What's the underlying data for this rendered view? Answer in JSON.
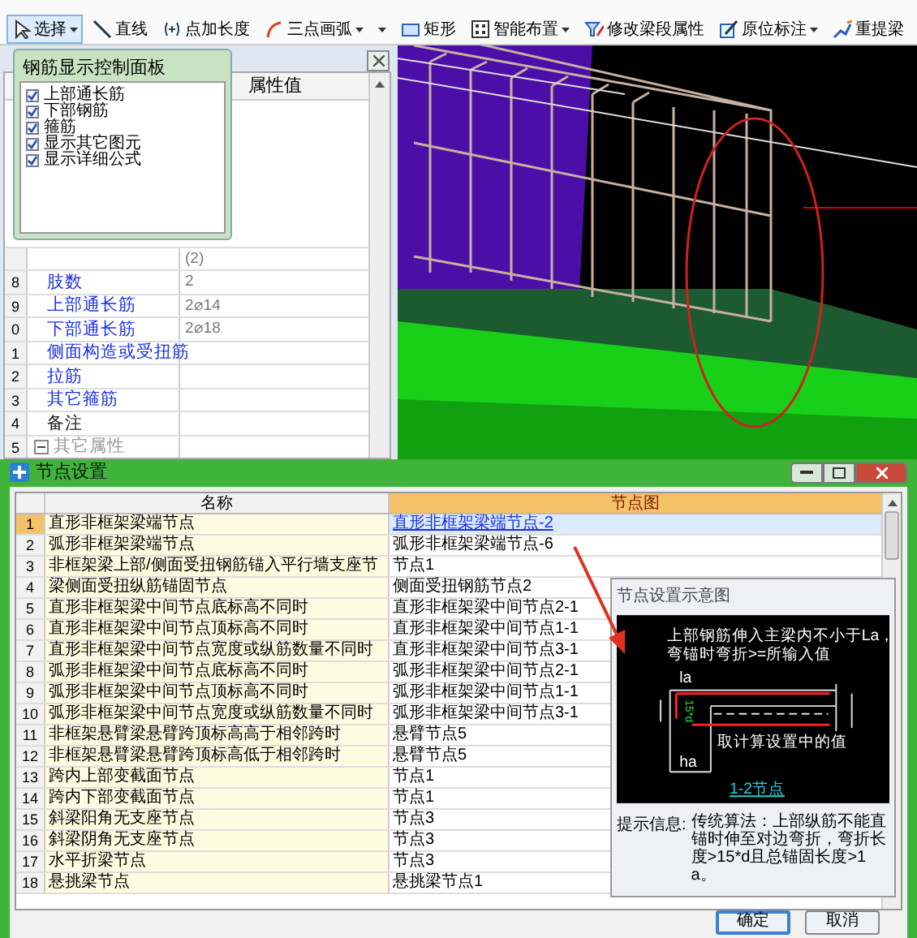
{
  "toolbar": {
    "items": [
      {
        "kind": "select",
        "label": "选择",
        "dropdown": true,
        "selected": true
      },
      {
        "kind": "line",
        "label": "直线",
        "dropdown": false,
        "selected": false
      },
      {
        "kind": "point-length",
        "label": "点加长度",
        "dropdown": false,
        "selected": false
      },
      {
        "kind": "arc",
        "label": "三点画弧",
        "dropdown": true,
        "selected": false
      },
      {
        "kind": "menu",
        "dropdown": true,
        "selected": false
      },
      {
        "kind": "rect",
        "label": "矩形",
        "dropdown": false,
        "selected": false
      },
      {
        "kind": "smart",
        "label": "智能布置",
        "dropdown": true,
        "selected": false
      },
      {
        "kind": "edit",
        "label": "修改梁段属性",
        "dropdown": false,
        "selected": false
      },
      {
        "kind": "annotate",
        "label": "原位标注",
        "dropdown": true,
        "selected": false
      },
      {
        "kind": "extract",
        "label": "重提梁",
        "dropdown": false,
        "selected": false
      }
    ]
  },
  "property_grid": {
    "header": "属性值",
    "rows": [
      {
        "value": "(2)"
      },
      {
        "number": "8",
        "name": "肢数",
        "value": "2",
        "kind": "link"
      },
      {
        "number": "9",
        "name": "上部通长筋",
        "value": "2⌀14",
        "kind": "link"
      },
      {
        "number": "0",
        "name": "下部通长筋",
        "value": "2⌀18",
        "kind": "link"
      },
      {
        "number": "1",
        "name": "侧面构造或受扭筋",
        "kind": "link"
      },
      {
        "number": "2",
        "name": "拉筋",
        "kind": "link"
      },
      {
        "number": "3",
        "name": "其它箍筋",
        "kind": "link"
      },
      {
        "number": "4",
        "name": "备注",
        "kind": "plain"
      },
      {
        "number": "5",
        "name": "其它属性",
        "kind": "group",
        "expanded": true
      }
    ]
  },
  "rebar_panel": {
    "title": "钢筋显示控制面板",
    "items": [
      {
        "label": "上部通长筋",
        "checked": true
      },
      {
        "label": "下部钢筋",
        "checked": true
      },
      {
        "label": "箍筋",
        "checked": true
      },
      {
        "label": "显示其它图元",
        "checked": true
      },
      {
        "label": "显示详细公式",
        "checked": true
      }
    ]
  },
  "node_dialog": {
    "title": "节点设置",
    "columns": [
      "名称",
      "节点图"
    ],
    "rows": [
      {
        "number": "1",
        "name": "直形非框架梁端节点",
        "node": "直形非框架梁端节点-2",
        "selected": true
      },
      {
        "number": "2",
        "name": "弧形非框架梁端节点",
        "node": "弧形非框架梁端节点-6",
        "selected": false
      },
      {
        "number": "3",
        "name": "非框架梁上部/侧面受扭钢筋锚入平行墙支座节",
        "node": "节点1",
        "selected": false
      },
      {
        "number": "4",
        "name": "梁侧面受扭纵筋锚固节点",
        "node": "侧面受扭钢筋节点2",
        "selected": false
      },
      {
        "number": "5",
        "name": "直形非框架梁中间节点底标高不同时",
        "node": "直形非框架梁中间节点2-1",
        "selected": false
      },
      {
        "number": "6",
        "name": "直形非框架梁中间节点顶标高不同时",
        "node": "直形非框架梁中间节点1-1",
        "selected": false
      },
      {
        "number": "7",
        "name": "直形非框架梁中间节点宽度或纵筋数量不同时",
        "node": "直形非框架梁中间节点3-1",
        "selected": false
      },
      {
        "number": "8",
        "name": "弧形非框架梁中间节点底标高不同时",
        "node": "弧形非框架梁中间节点2-1",
        "selected": false
      },
      {
        "number": "9",
        "name": "弧形非框架梁中间节点顶标高不同时",
        "node": "弧形非框架梁中间节点1-1",
        "selected": false
      },
      {
        "number": "10",
        "name": "弧形非框架梁中间节点宽度或纵筋数量不同时",
        "node": "弧形非框架梁中间节点3-1",
        "selected": false
      },
      {
        "number": "11",
        "name": "非框架悬臂梁悬臂跨顶标高高于相邻跨时",
        "node": "悬臂节点5",
        "selected": false
      },
      {
        "number": "12",
        "name": "非框架悬臂梁悬臂跨顶标高低于相邻跨时",
        "node": "悬臂节点5",
        "selected": false
      },
      {
        "number": "13",
        "name": "跨内上部变截面节点",
        "node": "节点1",
        "selected": false
      },
      {
        "number": "14",
        "name": "跨内下部变截面节点",
        "node": "节点1",
        "selected": false
      },
      {
        "number": "15",
        "name": "斜梁阳角无支座节点",
        "node": "节点3",
        "selected": false
      },
      {
        "number": "16",
        "name": "斜梁阴角无支座节点",
        "node": "节点3",
        "selected": false
      },
      {
        "number": "17",
        "name": "水平折梁节点",
        "node": "节点3",
        "selected": false
      },
      {
        "number": "18",
        "name": "悬挑梁节点",
        "node": "悬挑梁节点1",
        "selected": false
      }
    ],
    "preview": {
      "title": "节点设置示意图",
      "note_lines": [
        "上部钢筋伸入主梁内不小于La，",
        "弯锚时弯折>=所输入值"
      ],
      "top_dim": "la",
      "bend_dim": "15*d",
      "calc_note": "取计算设置中的值",
      "bottom_dim": "ha",
      "node_link": "1-2节点",
      "hint_label": "提示信息:",
      "hint": "传统算法：上部纵筋不能直锚时伸至对边弯折，弯折长度>15*d且总锚固长度>1a。"
    },
    "buttons": [
      "确定",
      "取消"
    ]
  }
}
